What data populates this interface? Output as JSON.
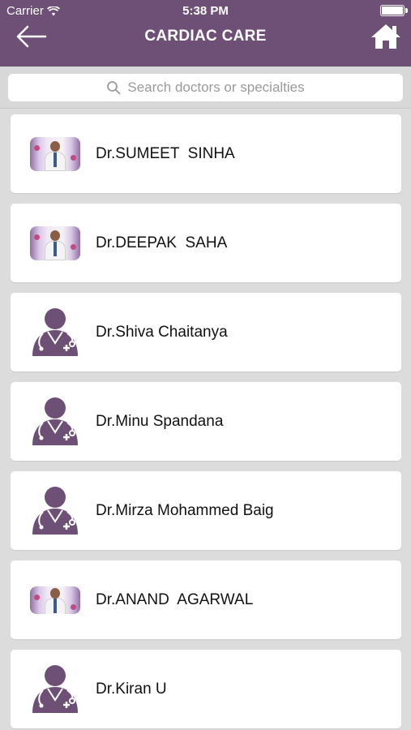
{
  "status_bar": {
    "carrier": "Carrier",
    "time": "5:38 PM"
  },
  "nav": {
    "title": "CARDIAC CARE"
  },
  "search": {
    "placeholder": "Search doctors or specialties"
  },
  "colors": {
    "header": "#6e5077",
    "avatar": "#6e5077",
    "background": "#dcdcdc"
  },
  "doctors": [
    {
      "name": "Dr.SUMEET  SINHA",
      "avatar": "photo"
    },
    {
      "name": "Dr.DEEPAK  SAHA",
      "avatar": "photo"
    },
    {
      "name": "Dr.Shiva Chaitanya",
      "avatar": "doctor-placeholder-icon"
    },
    {
      "name": "Dr.Minu Spandana",
      "avatar": "doctor-placeholder-icon"
    },
    {
      "name": "Dr.Mirza Mohammed Baig",
      "avatar": "doctor-placeholder-icon"
    },
    {
      "name": "Dr.ANAND  AGARWAL",
      "avatar": "photo"
    },
    {
      "name": "Dr.Kiran U",
      "avatar": "doctor-placeholder-icon"
    }
  ]
}
